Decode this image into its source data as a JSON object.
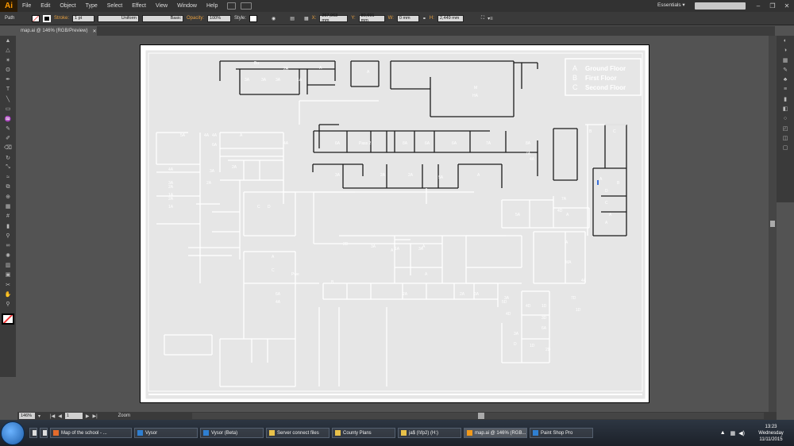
{
  "app": {
    "logo": "Ai"
  },
  "menubar": {
    "items": [
      "File",
      "Edit",
      "Object",
      "Type",
      "Select",
      "Effect",
      "View",
      "Window",
      "Help"
    ],
    "workspace": "Essentials",
    "window_controls": [
      "–",
      "❐",
      "✕"
    ]
  },
  "controlbar": {
    "object_type": "Path",
    "stroke_label": "Stroke:",
    "stroke_value": "1 pt",
    "profile": "Uniform",
    "brush": "Basic",
    "opacity_label": "Opacity:",
    "opacity_value": "100%",
    "style_label": "Style:",
    "x_label": "X:",
    "x_value": "267,963 mm",
    "y_label": "Y:",
    "y_value": "80,691 mm",
    "w_label": "W:",
    "w_value": "0 mm",
    "h_label": "H:",
    "h_value": "2,449 mm"
  },
  "document": {
    "tab_title": "map.ai @ 146% (RGB/Preview)",
    "tab_close": "✕"
  },
  "floorplan": {
    "legend": [
      {
        "symbol": "A",
        "label": "Ground Floor"
      },
      {
        "symbol": "B",
        "label": "First Floor"
      },
      {
        "symbol": "C",
        "label": "Second Floor"
      }
    ],
    "room_labels": [
      "Bu",
      "3A",
      "3A",
      "3A",
      "2A",
      "1A",
      "A",
      "A",
      "M",
      "HA",
      "A",
      "4A",
      "4A",
      "5A",
      "6A",
      "4A",
      "6A",
      "Pass 2",
      "8A",
      "6A",
      "6A",
      "7A",
      "8A",
      "7A",
      "4A",
      "3A",
      "2A",
      "2A",
      "A",
      "5A",
      "4A",
      "3A",
      "2A",
      "1A",
      "3A",
      "2A",
      "2A",
      "C",
      "D",
      "B",
      "C",
      "A",
      "B",
      "D",
      "C",
      "A",
      "A",
      "2A",
      "1A",
      "5A",
      "A",
      "4D",
      "7A",
      "A",
      "MA",
      "6A",
      "4A",
      "A",
      "Pwe",
      "B",
      "C",
      "2D",
      "3A",
      "A",
      "3A",
      "A",
      "1A",
      "2A",
      "2A",
      "3A",
      "A",
      "4A",
      "3A",
      "7D",
      "1D",
      "4D",
      "1D",
      "1D",
      "2D",
      "3D",
      "3A",
      "D",
      "6A",
      "5D",
      "4D"
    ]
  },
  "statusbar": {
    "zoom": "146%",
    "page": "1",
    "tool": "Zoom"
  },
  "taskbar": {
    "tasks": [
      "Map of the school - ...",
      "Vysor",
      "Vysor (Beta)",
      "Server connect files",
      "County Plans",
      "ja$ (\\\\fp2) (H:)",
      "map.ai @ 146% (RGB...",
      "Paint Shop Pro"
    ],
    "active_index": 6,
    "clock_time": "13:23",
    "clock_day": "Wednesday",
    "clock_date": "11/11/2015"
  },
  "colors": {
    "ui_bg": "#535353",
    "menubar": "#323232",
    "logo": "#ff9a00",
    "artboard": "#ffffff"
  }
}
